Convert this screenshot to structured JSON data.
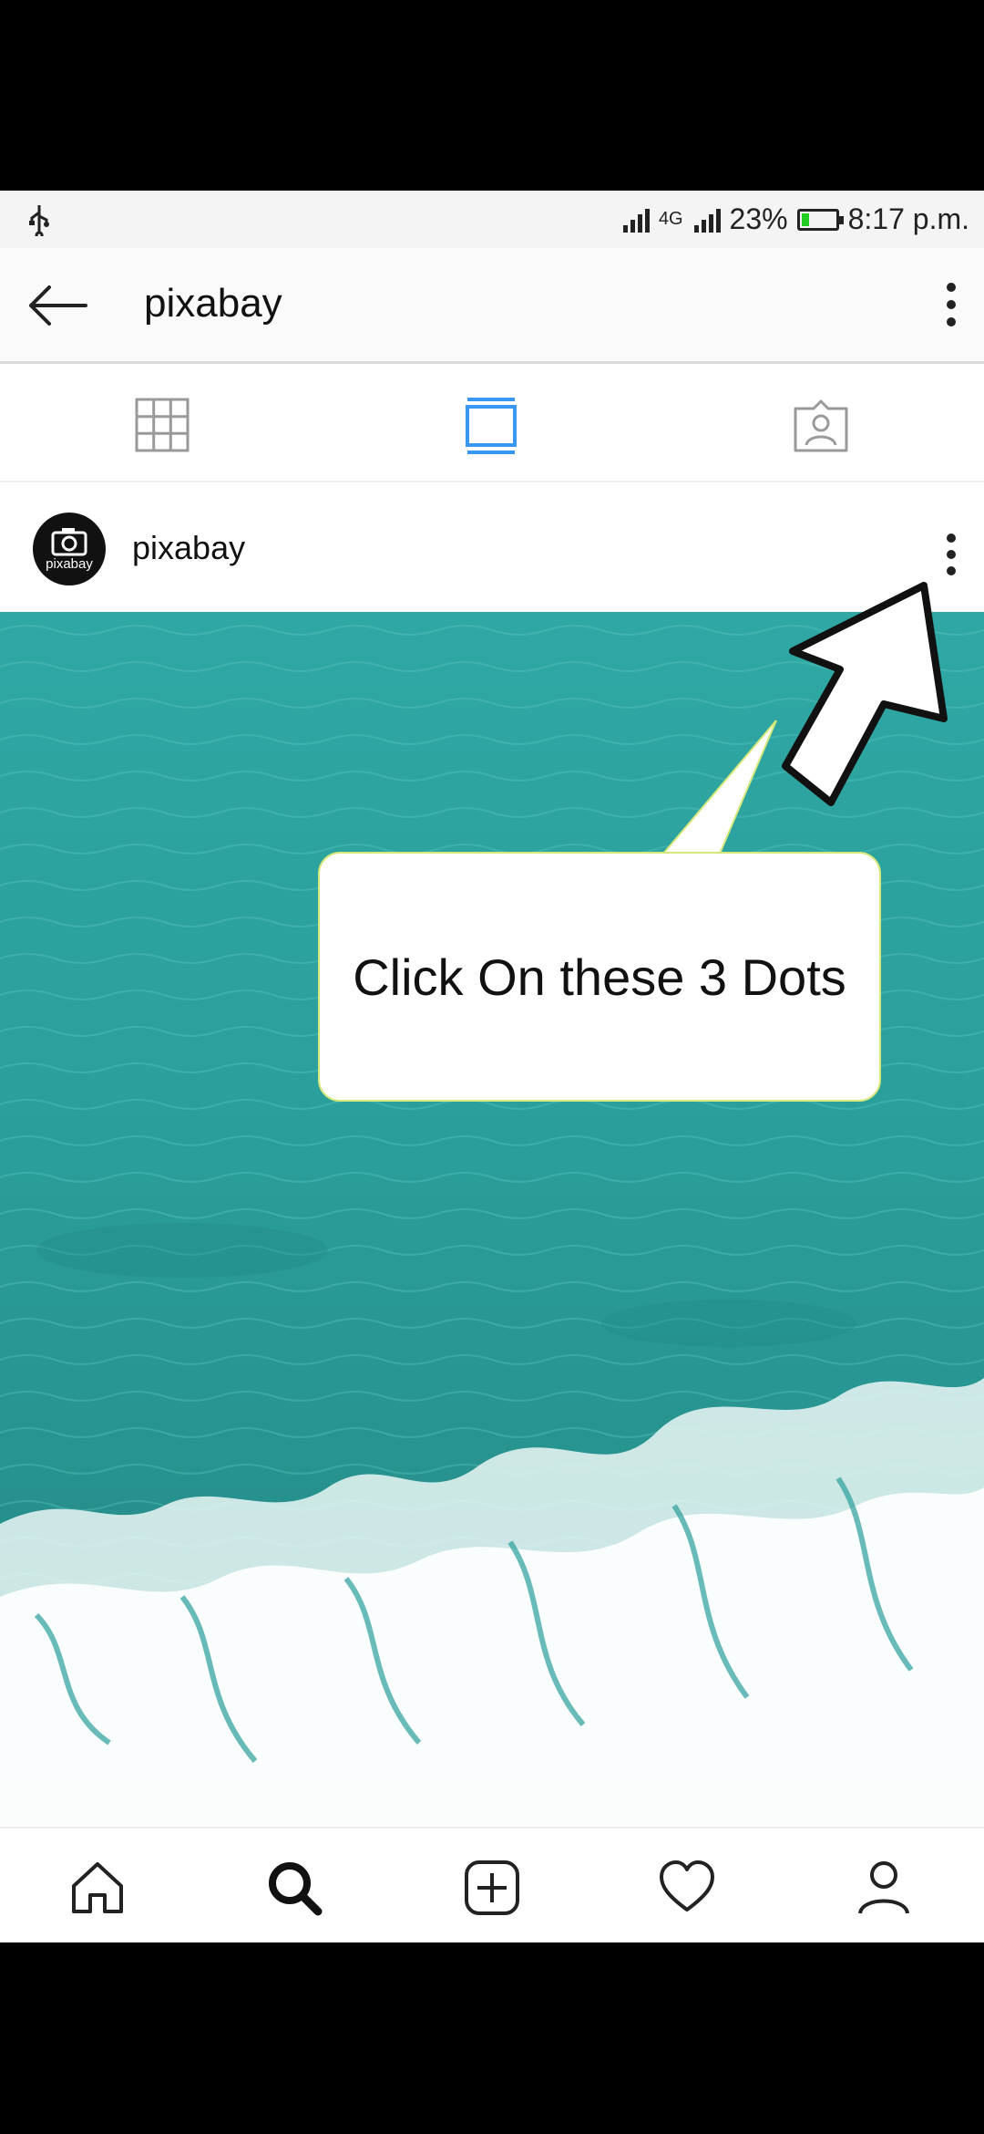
{
  "status_bar": {
    "network": "4G",
    "battery_percent": "23%",
    "battery_level": 0.23,
    "time": "8:17 p.m.",
    "icons": [
      "usb-icon",
      "signal-icon",
      "battery-icon"
    ]
  },
  "top_bar": {
    "title": "pixabay",
    "icons": [
      "back-arrow-icon",
      "more-options-icon"
    ]
  },
  "tabs": [
    {
      "name": "grid",
      "icon": "grid-icon",
      "active": false
    },
    {
      "name": "feed",
      "icon": "feed-icon",
      "active": true
    },
    {
      "name": "tagged",
      "icon": "tagged-icon",
      "active": false
    }
  ],
  "post": {
    "username": "pixabay",
    "avatar_brand": "pixabay",
    "icons": [
      "camera-icon",
      "post-options-icon"
    ]
  },
  "callout": {
    "text": "Click On these 3 Dots"
  },
  "bottom_nav": [
    {
      "name": "home",
      "icon": "home-icon"
    },
    {
      "name": "search",
      "icon": "search-icon",
      "active": true
    },
    {
      "name": "new-post",
      "icon": "add-post-icon"
    },
    {
      "name": "activity",
      "icon": "heart-icon"
    },
    {
      "name": "profile",
      "icon": "profile-icon"
    }
  ],
  "colors": {
    "accent": "#3897f0",
    "sea": "#2aa39f",
    "callout_border": "#d7e87a",
    "battery": "#22cc22"
  }
}
